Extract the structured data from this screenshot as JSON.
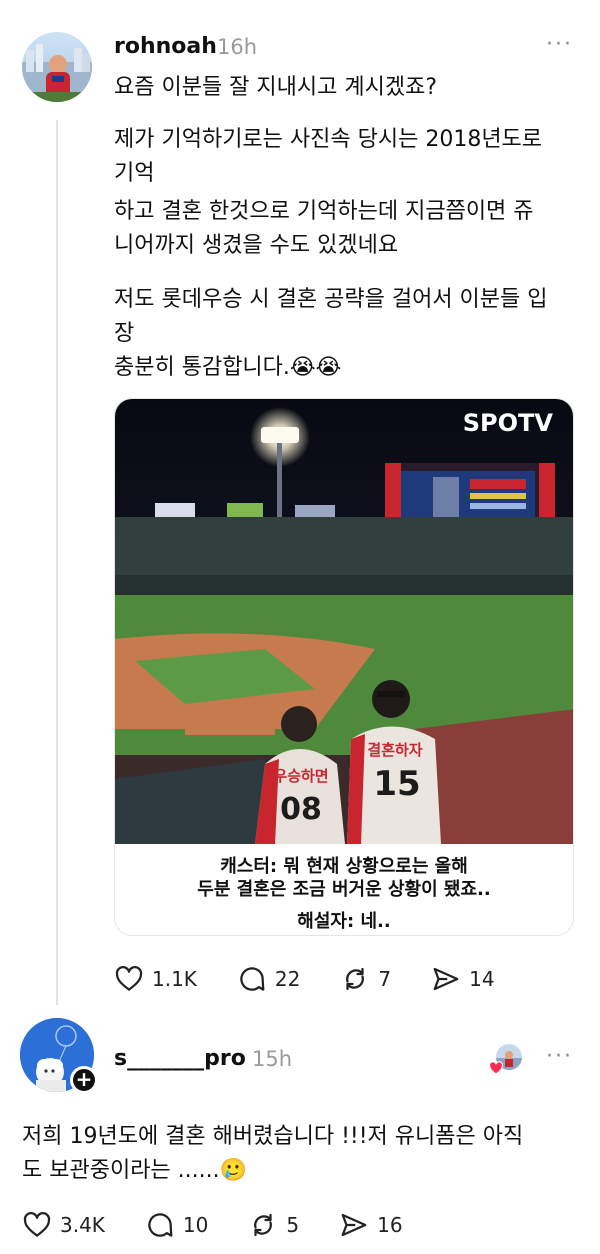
{
  "post1": {
    "username": "rohnoah",
    "time": "16h",
    "more": "···",
    "lines": [
      "요즘 이분들 잘 지내시고 계시겠죠?",
      "제가 기억하기로는 사진속 당시는 2018년도로",
      "기억",
      "하고 결혼 한것으로 기억하는데 지금쯤이면 쥬",
      "니어까지 생겼을 수도 있겠네요",
      "저도 롯데우승 시 결혼 공략을 걸어서 이분들 입",
      "장",
      "충분히 통감합니다.😭😭"
    ],
    "media": {
      "watermark": "SPOTV",
      "jersey_left_name": "우승하면",
      "jersey_left_number": "08",
      "jersey_right_name": "결혼하자",
      "jersey_right_number": "15",
      "caption_1": "캐스터: 뭐 현재 상황으로는 올해",
      "caption_2": "두분 결혼은 조금 버거운 상황이 됐죠..",
      "caption_3": "해설자: 네.."
    },
    "actions": {
      "likes": "1.1K",
      "replies": "22",
      "reposts": "7",
      "shares": "14"
    }
  },
  "post2": {
    "username": "s_______pro",
    "time": "15h",
    "more": "···",
    "lines": [
      "저희 19년도에 결혼 해버렸습니다 !!!저 유니폼은 아직",
      "도 보관중이라는 ......🥲"
    ],
    "actions": {
      "likes": "3.4K",
      "replies": "10",
      "reposts": "5",
      "shares": "16"
    }
  },
  "colors": {
    "jersey_red": "#c8252f",
    "field_green": "#4f8a3c",
    "dirt": "#c77a4e",
    "sky": "#0c0f1a"
  },
  "icons": [
    "heart-icon",
    "comment-icon",
    "repost-icon",
    "share-icon",
    "more-icon",
    "plus-icon"
  ]
}
